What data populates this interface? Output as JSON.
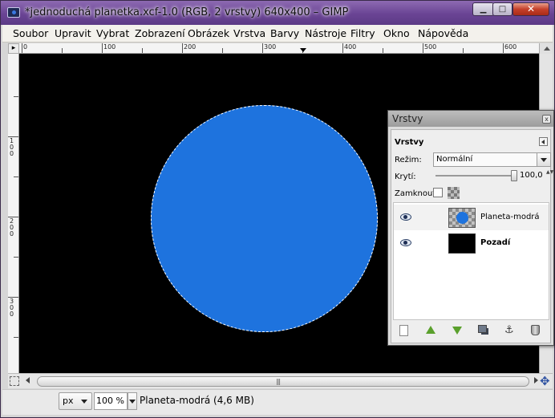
{
  "window": {
    "title": "*jednoduchá planetka.xcf-1.0 (RGB, 2 vrstvy) 640x400 – GIMP",
    "min_label": "▁",
    "max_label": "□",
    "close_label": "✕"
  },
  "menu": [
    "Soubor",
    "Upravit",
    "Vybrat",
    "Zobrazení",
    "Obrázek",
    "Vrstva",
    "Barvy",
    "Nástroje",
    "Filtry",
    "Okno",
    "Nápověda"
  ],
  "ruler": {
    "corner_label": "▸",
    "h_labels": [
      "0",
      "100",
      "200",
      "300",
      "400",
      "500",
      "600"
    ],
    "v_labels": [
      "100",
      "200",
      "300"
    ]
  },
  "canvas": {
    "background": "#000000",
    "planet_color": "#1e73de",
    "selection": "circle-marching-ants"
  },
  "scrollbar": {
    "grip": "|||"
  },
  "status": {
    "unit": "px",
    "zoom": "100 %",
    "text": "Planeta-modrá (4,6 MB)"
  },
  "layers_window": {
    "title": "Vrstvy",
    "close_label": "x",
    "dock_title": "Vrstvy",
    "mode_label": "Režim:",
    "mode_value": "Normální",
    "opacity_label": "Krytí:",
    "opacity_value": "100,0",
    "opacity_fraction": 1.0,
    "lock_label": "Zamknout:",
    "layers": [
      {
        "name": "Planeta-modrá",
        "visible": true,
        "bold": false
      },
      {
        "name": "Pozadí",
        "visible": true,
        "bold": true
      }
    ],
    "anchor_icon": "⚓"
  },
  "colors": {
    "title_bar": "#6a4494",
    "close_button": "#c5402a",
    "planet": "#1e73de",
    "action_arrow": "#5aa02c"
  }
}
